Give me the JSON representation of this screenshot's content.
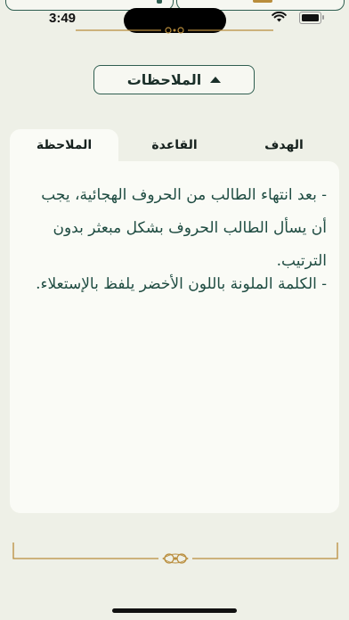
{
  "status_bar": {
    "time": "3:49"
  },
  "dropdown": {
    "label": "الملاحظات"
  },
  "tabs": [
    {
      "label": "الهدف"
    },
    {
      "label": "القاعدة"
    },
    {
      "label": "الملاحظة"
    }
  ],
  "note": {
    "lines": [
      "- بعد انتهاء الطالب من الحروف الهجائية، يجب أن يسأل الطالب الحروف بشكل مبعثر بدون الترتيب.",
      "- الكلمة الملونة باللون الأخضر يلفظ بالإستعلاء."
    ]
  },
  "colors": {
    "accent": "#2f5e50",
    "gold": "#b98d3c",
    "background": "#eef0e7",
    "card": "#fafbf6"
  }
}
